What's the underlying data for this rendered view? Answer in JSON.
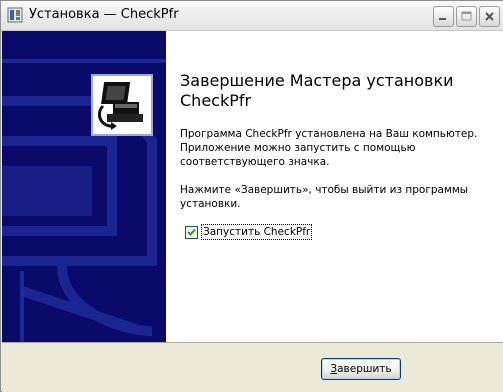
{
  "window": {
    "title": "Установка — CheckPfr"
  },
  "wizard": {
    "heading_line1": "Завершение Мастера установки",
    "heading_line2": "CheckPfr",
    "para1_line1": "Программа CheckPfr установлена на Ваш компьютер.",
    "para1_line2": "Приложение можно запустить с помощью",
    "para1_line3": "соответствующего значка.",
    "para2_line1": "Нажмите «Завершить», чтобы выйти из программы",
    "para2_line2": "установки.",
    "launch_checkbox": {
      "label": "Запустить CheckPfr",
      "checked": true
    }
  },
  "buttons": {
    "finish_underlined": "З",
    "finish_rest": "авершить"
  },
  "colors": {
    "side_panel": "#0a0a6a",
    "accent": "#003c74"
  },
  "icons": {
    "app": "installer-app-icon",
    "logo": "computer-install-logo-icon",
    "minimize": "minimize-icon",
    "maximize": "maximize-icon",
    "close": "close-icon",
    "check": "checkmark-icon"
  }
}
